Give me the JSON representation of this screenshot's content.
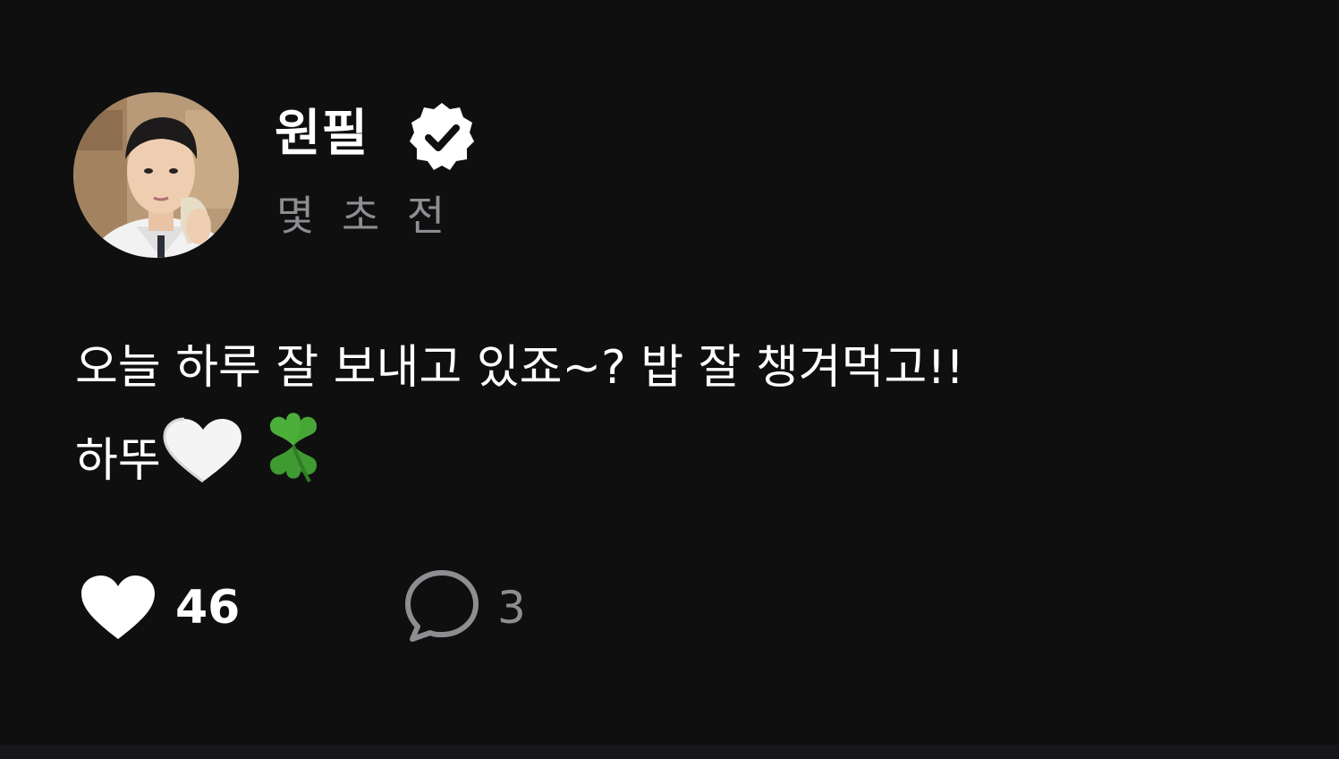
{
  "post": {
    "author": {
      "name": "원필",
      "verified": true
    },
    "timestamp": "몇 초 전",
    "body": {
      "line1": "오늘 하루 잘 보내고 있죠~? 밥 잘 챙겨먹고!!",
      "line2_prefix": "하뚜",
      "emojis": [
        "white-heart-icon",
        "four-leaf-clover-icon"
      ]
    },
    "stats": {
      "likes": "46",
      "comments": "3"
    }
  },
  "colors": {
    "background": "#0f0f10",
    "text": "#ffffff",
    "muted": "#8e8e92",
    "clover": "#4caf3a"
  }
}
